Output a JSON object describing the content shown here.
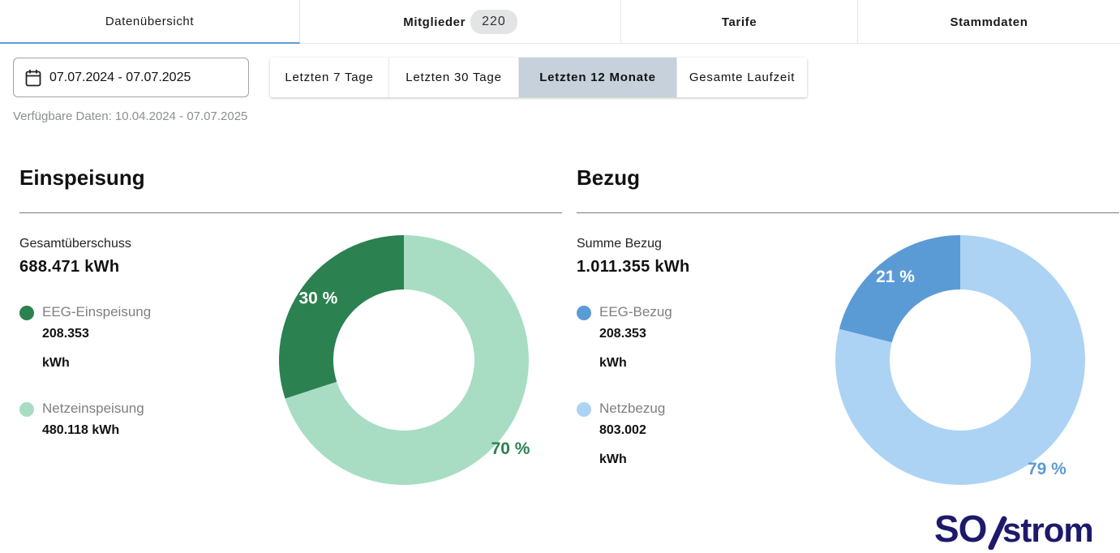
{
  "tabs": [
    {
      "label": "Datenübersicht",
      "active": true
    },
    {
      "label": "Mitglieder",
      "badge": "220"
    },
    {
      "label": "Tarife"
    },
    {
      "label": "Stammdaten"
    }
  ],
  "date_range": {
    "value": "07.07.2024 - 07.07.2025",
    "icon": "calendar-icon"
  },
  "range_buttons": [
    {
      "label": "Letzten 7 Tage"
    },
    {
      "label": "Letzten 30 Tage"
    },
    {
      "label": "Letzten 12 Monate",
      "active": true
    },
    {
      "label": "Gesamte Laufzeit"
    }
  ],
  "available_data": "Verfügbare Daten: 10.04.2024 - 07.07.2025",
  "einspeisung": {
    "title": "Einspeisung",
    "sum_label": "Gesamtüberschuss",
    "sum_value": "688.471 kWh",
    "items": [
      {
        "name": "EEG-Einspeisung",
        "value_line1": "208.353",
        "value_line2": "kWh",
        "color": "#2b8150"
      },
      {
        "name": "Netzeinspeisung",
        "value_line1": "480.118 kWh",
        "color": "#a8ddc3"
      }
    ]
  },
  "bezug": {
    "title": "Bezug",
    "sum_label": "Summe Bezug",
    "sum_value": "1.011.355 kWh",
    "items": [
      {
        "name": "EEG-Bezug",
        "value_line1": "208.353",
        "value_line2": "kWh",
        "color": "#5b9bd5"
      },
      {
        "name": "Netzbezug",
        "value_line1": "803.002",
        "value_line2": "kWh",
        "color": "#acd3f4"
      }
    ]
  },
  "chart_data": [
    {
      "type": "pie",
      "categories": [
        "EEG-Einspeisung",
        "Netzeinspeisung"
      ],
      "values": [
        30,
        70
      ],
      "labels": [
        "30 %",
        "70 %"
      ],
      "colors": [
        "#2b8150",
        "#a8ddc3"
      ],
      "label_colors": [
        "#ffffff",
        "#2b8150"
      ]
    },
    {
      "type": "pie",
      "categories": [
        "EEG-Bezug",
        "Netzbezug"
      ],
      "values": [
        21,
        79
      ],
      "labels": [
        "21 %",
        "79 %"
      ],
      "colors": [
        "#5b9bd5",
        "#acd3f4"
      ],
      "label_colors": [
        "#ffffff",
        "#5b9bd5"
      ]
    }
  ],
  "logo": {
    "text": "SO/strom",
    "color": "#1d1a6b"
  }
}
